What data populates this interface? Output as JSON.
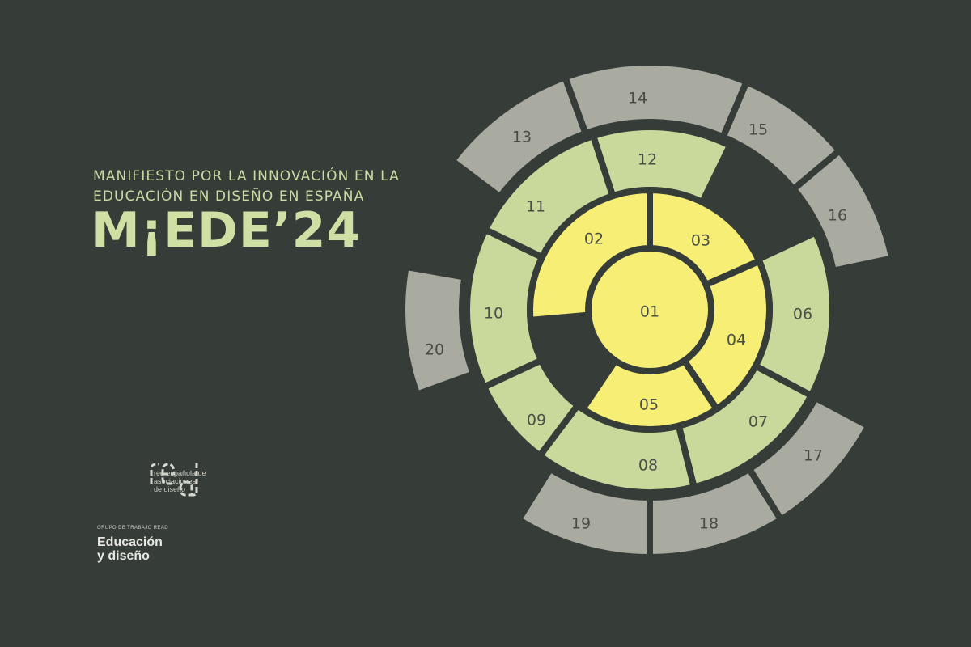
{
  "header": {
    "subtitle_line1": "MANIFIESTO POR LA INNOVACIÓN EN LA",
    "subtitle_line2": "EDUCACIÓN EN DISEÑO EN ESPAÑA",
    "title": "M¡EDE’24"
  },
  "logo": {
    "mark": "read",
    "tagline_line1": "red española de",
    "tagline_line2": "asociaciones",
    "tagline_line3": "de diseño"
  },
  "group": {
    "label": "GRUPO DE TRABAJO READ",
    "name_line1": "Educación",
    "name_line2": "y diseño"
  },
  "colors": {
    "background": "#363d39",
    "inner": "#f6ee75",
    "middle": "#c9d99c",
    "outer": "#a9aba1",
    "label": "#4a4f47",
    "outer_label": "#484c45",
    "title": "#cfe0a4"
  },
  "segments": {
    "center": "01",
    "inner": [
      "02",
      "03",
      "04",
      "05"
    ],
    "middle": [
      "06",
      "07",
      "08",
      "09",
      "10",
      "11",
      "12"
    ],
    "outer": [
      "13",
      "14",
      "15",
      "16",
      "17",
      "18",
      "19",
      "20"
    ]
  }
}
